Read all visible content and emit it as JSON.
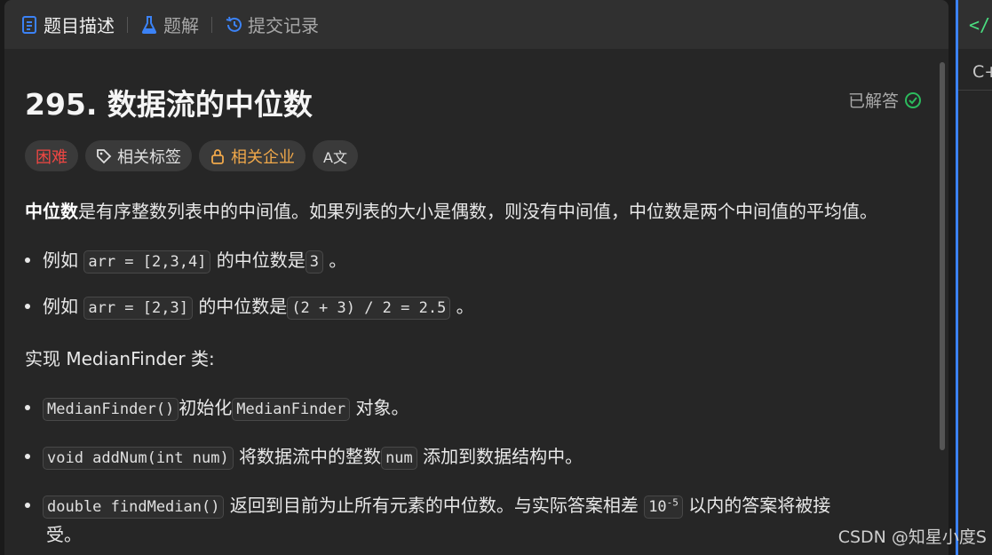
{
  "tabs": [
    {
      "label": "题目描述",
      "icon": "description-icon"
    },
    {
      "label": "题解",
      "icon": "flask-icon"
    },
    {
      "label": "提交记录",
      "icon": "history-icon"
    }
  ],
  "problem": {
    "title": "295. 数据流的中位数",
    "status": "已解答",
    "tags": {
      "difficulty": "困难",
      "related_tags": "相关标签",
      "related_companies": "相关企业",
      "translate": "A文"
    }
  },
  "description": {
    "intro_bold": "中位数",
    "intro_rest": "是有序整数列表中的中间值。如果列表的大小是偶数，则没有中间值，中位数是两个中间值的平均值。",
    "ex1_prefix": "例如",
    "ex1_code": "arr = [2,3,4]",
    "ex1_mid": "的中位数是",
    "ex1_val": "3",
    "ex1_end": "。",
    "ex2_prefix": "例如",
    "ex2_code": "arr = [2,3]",
    "ex2_mid": "的中位数是",
    "ex2_val": "(2 + 3) / 2 = 2.5",
    "ex2_end": "。",
    "impl": "实现 MedianFinder 类:",
    "m1_code": "MedianFinder()",
    "m1_text": "初始化",
    "m1_code2": "MedianFinder",
    "m1_end": "对象。",
    "m2_code": "void addNum(int num)",
    "m2_text": "将数据流中的整数",
    "m2_code2": "num",
    "m2_end": "添加到数据结构中。",
    "m3_code": "double findMedian()",
    "m3_text": "返回到目前为止所有元素的中位数。与实际答案相差",
    "m3_code2_base": "10",
    "m3_code2_exp": "-5",
    "m3_end": "以内的答案将被接",
    "m3_wrap": "受。"
  },
  "editor": {
    "lang": "C+"
  },
  "watermark": "CSDN @知星小度S",
  "colors": {
    "hard": "#ef4743",
    "company": "#f0a84a",
    "solved_check": "#2cbb5d",
    "accent_blue": "#3b82f6"
  }
}
